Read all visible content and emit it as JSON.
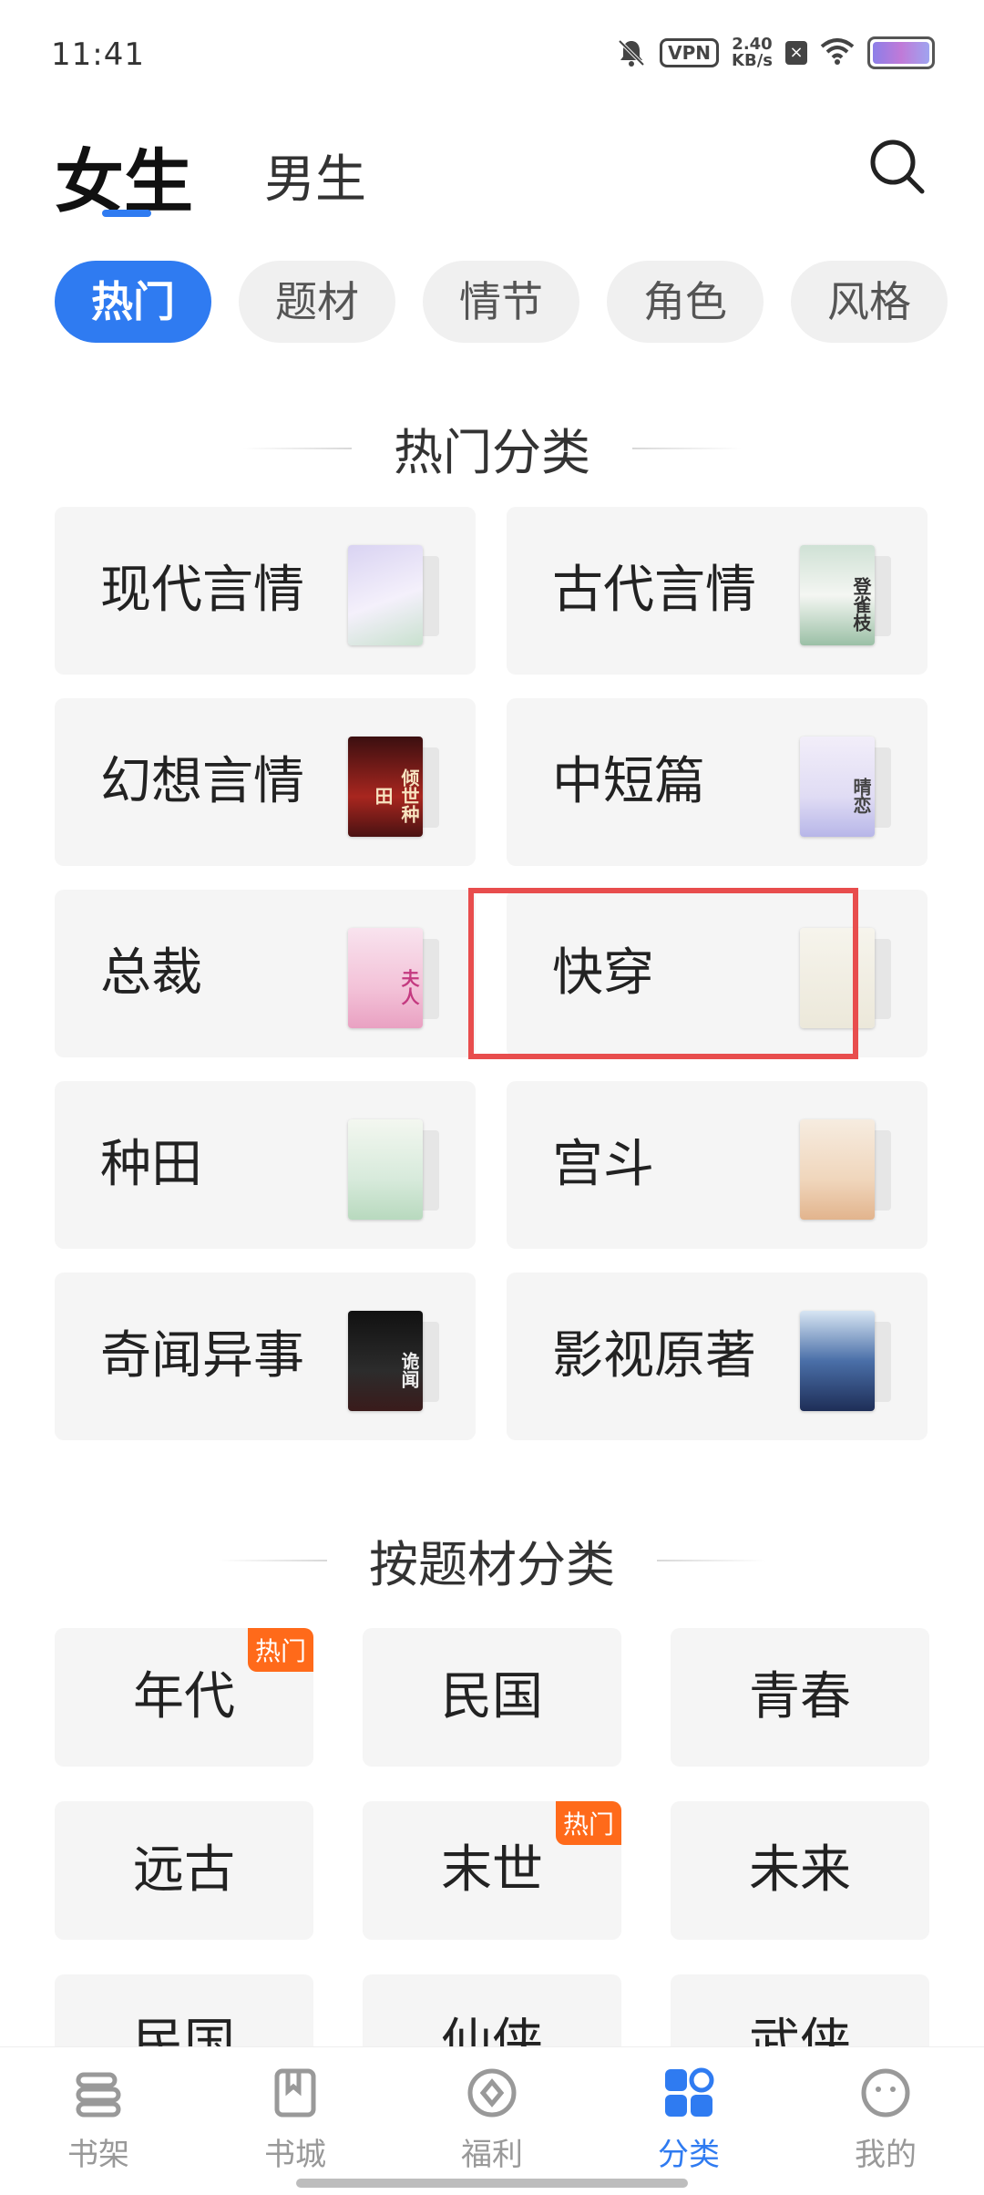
{
  "status_bar": {
    "time": "11:41",
    "vpn": "VPN",
    "speed_value": "2.40",
    "speed_unit": "KB/s"
  },
  "gender_tabs": {
    "female": "女生",
    "male": "男生"
  },
  "filter_chips": [
    "热门",
    "题材",
    "情节",
    "角色",
    "风格"
  ],
  "hot_section": {
    "title": "热门分类",
    "items": [
      {
        "label": "现代言情",
        "cover_color": "#e9e3f5",
        "cover_text": ""
      },
      {
        "label": "古代言情",
        "cover_color": "#e6efe9",
        "cover_text": "登雀枝"
      },
      {
        "label": "幻想言情",
        "cover_color": "#8b1e1e",
        "cover_text": "倾世种田"
      },
      {
        "label": "中短篇",
        "cover_color": "#ecebf7",
        "cover_text": "晴恋"
      },
      {
        "label": "总裁",
        "cover_color": "#f6dbe8",
        "cover_text": "夫人"
      },
      {
        "label": "快穿",
        "cover_color": "#f1efe6",
        "cover_text": ""
      },
      {
        "label": "种田",
        "cover_color": "#e8f2ea",
        "cover_text": ""
      },
      {
        "label": "宫斗",
        "cover_color": "#f3e6d8",
        "cover_text": ""
      },
      {
        "label": "奇闻异事",
        "cover_color": "#1a1a1a",
        "cover_text": "诡闻"
      },
      {
        "label": "影视原著",
        "cover_color": "#2a3b6b",
        "cover_text": ""
      }
    ]
  },
  "theme_section": {
    "title": "按题材分类",
    "items": [
      {
        "label": "年代",
        "badge": "热门"
      },
      {
        "label": "民国",
        "badge": ""
      },
      {
        "label": "青春",
        "badge": ""
      },
      {
        "label": "远古",
        "badge": ""
      },
      {
        "label": "末世",
        "badge": "热门"
      },
      {
        "label": "未来",
        "badge": ""
      },
      {
        "label": "民国",
        "badge": ""
      },
      {
        "label": "仙侠",
        "badge": ""
      },
      {
        "label": "武侠",
        "badge": ""
      }
    ]
  },
  "bottom_nav": [
    {
      "label": "书架",
      "icon": "bookshelf-icon"
    },
    {
      "label": "书城",
      "icon": "bookstore-icon"
    },
    {
      "label": "福利",
      "icon": "welfare-icon"
    },
    {
      "label": "分类",
      "icon": "category-icon"
    },
    {
      "label": "我的",
      "icon": "profile-icon"
    }
  ],
  "colors": {
    "accent": "#2f7bf1",
    "badge": "#ff6a1a",
    "highlight": "#e84d4d"
  }
}
